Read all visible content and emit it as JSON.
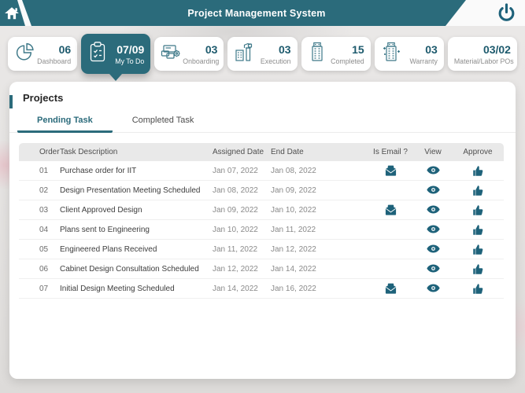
{
  "header": {
    "title": "Project Management System"
  },
  "nav_cards": [
    {
      "value": "06",
      "label": "Dashboard",
      "selected": false
    },
    {
      "value": "07/09",
      "label": "My To Do",
      "selected": true
    },
    {
      "value": "03",
      "label": "Onboarding",
      "selected": false
    },
    {
      "value": "03",
      "label": "Execution",
      "selected": false
    },
    {
      "value": "15",
      "label": "Completed",
      "selected": false
    },
    {
      "value": "03",
      "label": "Warranty",
      "selected": false
    },
    {
      "value": "03/02",
      "label": "Material/Labor POs",
      "selected": false
    }
  ],
  "projects": {
    "heading": "Projects",
    "tabs": [
      {
        "label": "Pending Task",
        "active": true
      },
      {
        "label": "Completed Task",
        "active": false
      }
    ],
    "table": {
      "columns": [
        "Order",
        "Task Description",
        "Assigned Date",
        "End Date",
        "Is Email ?",
        "View",
        "Approve"
      ],
      "rows": [
        {
          "order": "01",
          "task": "Purchase order for IIT",
          "assigned": "Jan 07, 2022",
          "end": "Jan 08, 2022",
          "is_email": true
        },
        {
          "order": "02",
          "task": "Design Presentation Meeting Scheduled",
          "assigned": "Jan 08, 2022",
          "end": "Jan 09, 2022",
          "is_email": false
        },
        {
          "order": "03",
          "task": "Client Approved Design",
          "assigned": "Jan 09, 2022",
          "end": "Jan 10, 2022",
          "is_email": true
        },
        {
          "order": "04",
          "task": "Plans sent to Engineering",
          "assigned": "Jan 10, 2022",
          "end": "Jan 11, 2022",
          "is_email": false
        },
        {
          "order": "05",
          "task": "Engineered Plans Received",
          "assigned": "Jan 11, 2022",
          "end": "Jan 12, 2022",
          "is_email": false
        },
        {
          "order": "06",
          "task": "Cabinet Design Consultation Scheduled",
          "assigned": "Jan 12, 2022",
          "end": "Jan 14, 2022",
          "is_email": false
        },
        {
          "order": "07",
          "task": "Initial Design Meeting Scheduled",
          "assigned": "Jan 14, 2022",
          "end": "Jan 16, 2022",
          "is_email": true
        }
      ]
    }
  },
  "colors": {
    "teal": "#2b6b7b",
    "number_teal": "#1d5a6d",
    "icon_teal": "#1e627a",
    "header_row_bg": "#e9e9e9"
  }
}
